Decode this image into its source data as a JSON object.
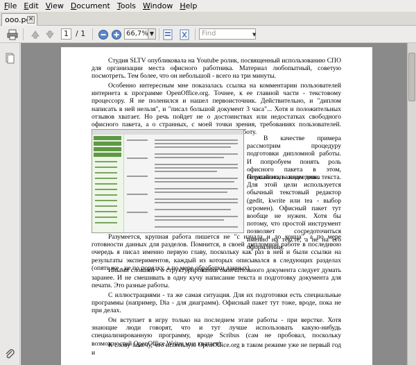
{
  "menu": [
    {
      "underline": "F",
      "rest": "ile"
    },
    {
      "underline": "E",
      "rest": "dit"
    },
    {
      "underline": "V",
      "rest": "iew"
    },
    {
      "underline": "D",
      "rest": "ocument"
    },
    {
      "underline": "T",
      "rest": "ools"
    },
    {
      "underline": "W",
      "rest": "indow"
    },
    {
      "underline": "H",
      "rest": "elp"
    }
  ],
  "tab": {
    "label": "ooo.pdf",
    "close": "✕"
  },
  "toolbar": {
    "page_value": "1",
    "page_count": "/ 1",
    "zoom_value": "66,7%",
    "find_placeholder": "Find"
  },
  "document": {
    "p1": "Студия SLTV опубликовала на Youtube ролик, посвященный использованию СПО для организации места офисного работника. Материал любопытный, советую посмотреть. Тем более, что он небольшой - всего на три минуты.",
    "p2": "Особенно интересным мне показалась ссылка на комментарии пользователей интернета к программе OpenOffice.org. Точнее, к ее главной части - текстовому процессору. Я не поленился и нашел первоисточник. Действительно, и \"диплом написать в ней нельзя\", и \"писал большой документ 3 часа\"... Хотя и положительных отзывов хватает. Но речь пойдет не о достоинствах или недостатках свободного офисного пакета, а о странных, с моей точки зрения, требованиях пользователей. Точнее - о их неумении организовать собственную работу.",
    "p3": "В качестве примера рассмотрим процедуру подготовки дипломной работы. И попробуем понять роль офисного пакета в этом, безусловно, важном деле.",
    "p4": "Первый этап - подготовка текста. Для этой цели используется обычный текстовый редактор (gedit, kwrite или tea - выбор огромен). Офисный пакет тут вообще не нужен. Хотя бы потому, что простой инструмент позволяет сосредоточиться именно на тексте, а не на его оформлении.",
    "p5": "Разумеется, крупная работа пишется не \"с начала и до конца\", а по мере готовности данных для разделов. Помнится, в своей дипломной работе в последнюю очередь я писал именно первую главу, поскольку как раз в ней и были ссылки на результаты экспериментов, каждый из которых описывался в следующих разделах (опять же - не по порядку, а по мере обработки данных).",
    "p6": "Иными словами - о структурировании окончательного документа следует думать заранее. И не смешивать в одну кучу написание текста и подготовку документа для печати. Это разные работы.",
    "p7": "С иллюстрациями - та же самая ситуация. Для их подготовки есть специальные программы (например, Dia - для диаграмм). Офисный пакет тут тоже, вроде, пока не при делах.",
    "p8": "Он вступает в игру только на последнем этапе работы - при верстке. Хотя знающие люди говорят, что и тут лучше использовать какую-нибудь специализированную программу, вроде Scribus (сам не пробовал, поскольку возможностей OpenOffice.Writer мне хватает).",
    "p9": "К слову замечу, что использую OpenOffice.org в таком режиме уже не первый год и"
  }
}
